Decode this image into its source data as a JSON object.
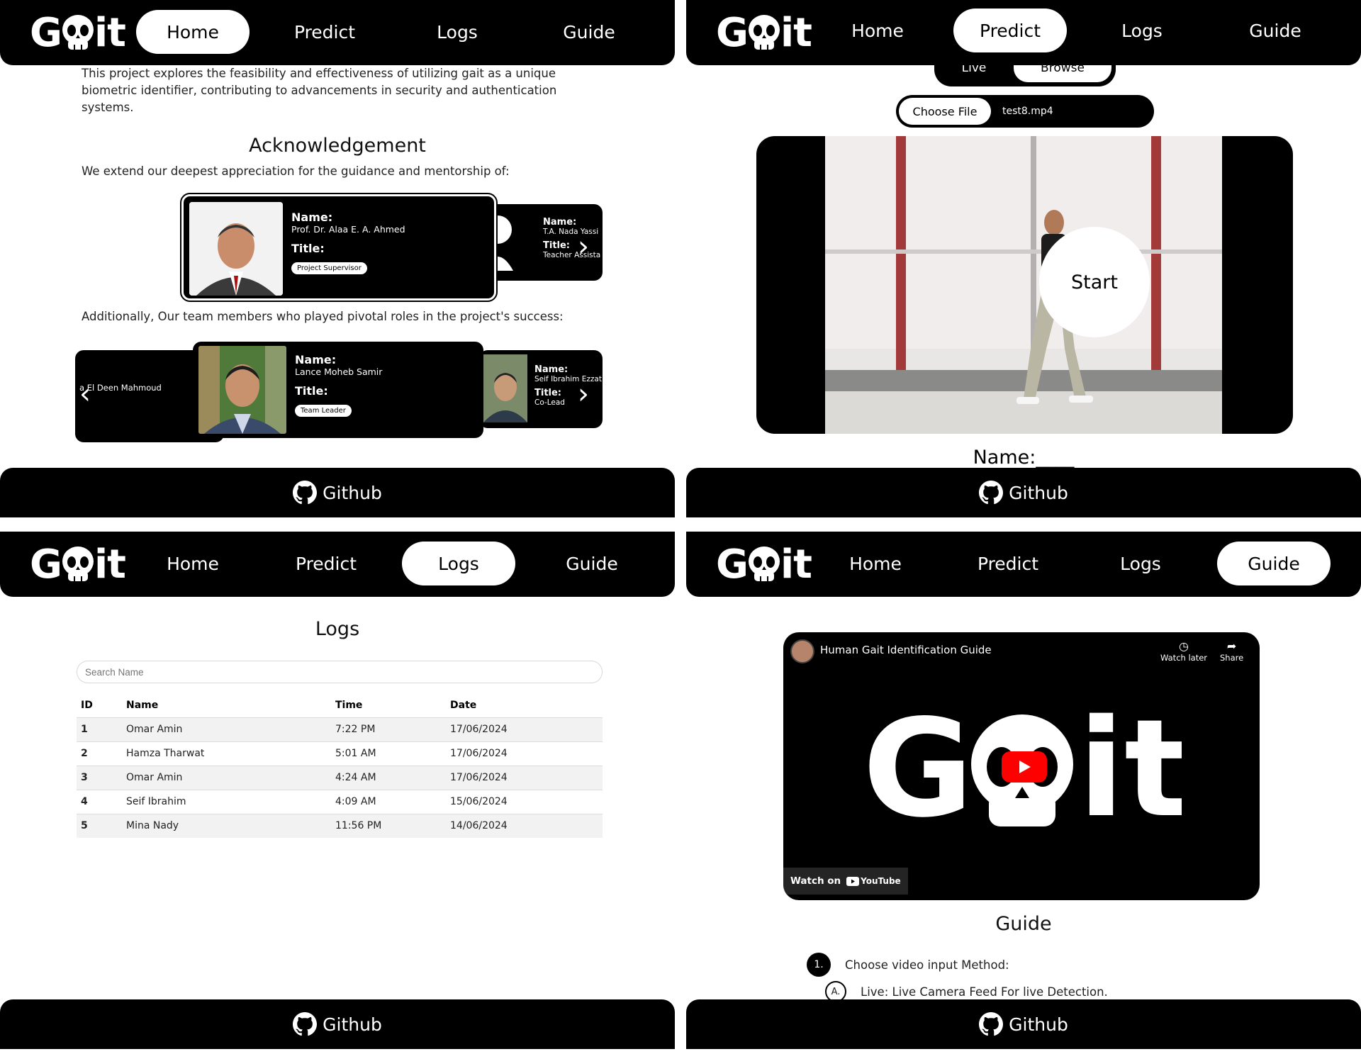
{
  "logo": {
    "text_left": "G",
    "text_right": "it",
    "icon": "skull-icon"
  },
  "nav": {
    "home": "Home",
    "predict": "Predict",
    "logs": "Logs",
    "guide": "Guide"
  },
  "footer": {
    "label": "Github",
    "icon": "github-icon"
  },
  "home": {
    "intro": "This project explores the feasibility and effectiveness of utilizing gait as a unique biometric identifier, contributing to advancements in security and authentication systems.",
    "ack_title": "Acknowledgement",
    "ack_text": "We extend our deepest appreciation for the guidance and mentorship of:",
    "team_text": "Additionally, Our team members who played pivotal roles in the project's success:",
    "name_label": "Name:",
    "title_label": "Title:",
    "supervisors": [
      {
        "name": "Prof. Dr. Alaa E. A. Ahmed",
        "title": "Project Supervisor"
      },
      {
        "name": "T.A. Nada Yassi",
        "title": "Teacher Assista"
      }
    ],
    "team": [
      {
        "name": "Lance Moheb Samir",
        "title": "Team Leader"
      },
      {
        "name": "Seif Ibrahim Ezzat",
        "title": "Co-Lead"
      },
      {
        "name": "a El Deen Mahmoud"
      }
    ]
  },
  "predict": {
    "mode_live": "Live",
    "mode_browse": "Browse",
    "choose_file": "Choose File",
    "file_name": "test8.mp4",
    "start": "Start",
    "name_output": "Name:____"
  },
  "logs": {
    "title": "Logs",
    "search_placeholder": "Search Name",
    "columns": [
      "ID",
      "Name",
      "Time",
      "Date"
    ],
    "rows": [
      [
        "1",
        "Omar Amin",
        "7:22 PM",
        "17/06/2024"
      ],
      [
        "2",
        "Hamza Tharwat",
        "5:01 AM",
        "17/06/2024"
      ],
      [
        "3",
        "Omar Amin",
        "4:24 AM",
        "17/06/2024"
      ],
      [
        "4",
        "Seif Ibrahim",
        "4:09 AM",
        "15/06/2024"
      ],
      [
        "5",
        "Mina Nady",
        "11:56 PM",
        "14/06/2024"
      ]
    ]
  },
  "guide": {
    "video_title": "Human Gait Identification Guide",
    "watch_later": "Watch later",
    "share": "Share",
    "watch_on": "Watch on",
    "youtube": "YouTube",
    "title": "Guide",
    "step1_num": "1.",
    "step1": "Choose video input Method:",
    "stepA_num": "A.",
    "stepA": "Live: Live Camera Feed For live Detection."
  },
  "colors": {
    "primary": "#000000",
    "background": "#ffffff",
    "youtube_red": "#ff0000",
    "row_stripe": "#f2f2f2"
  }
}
